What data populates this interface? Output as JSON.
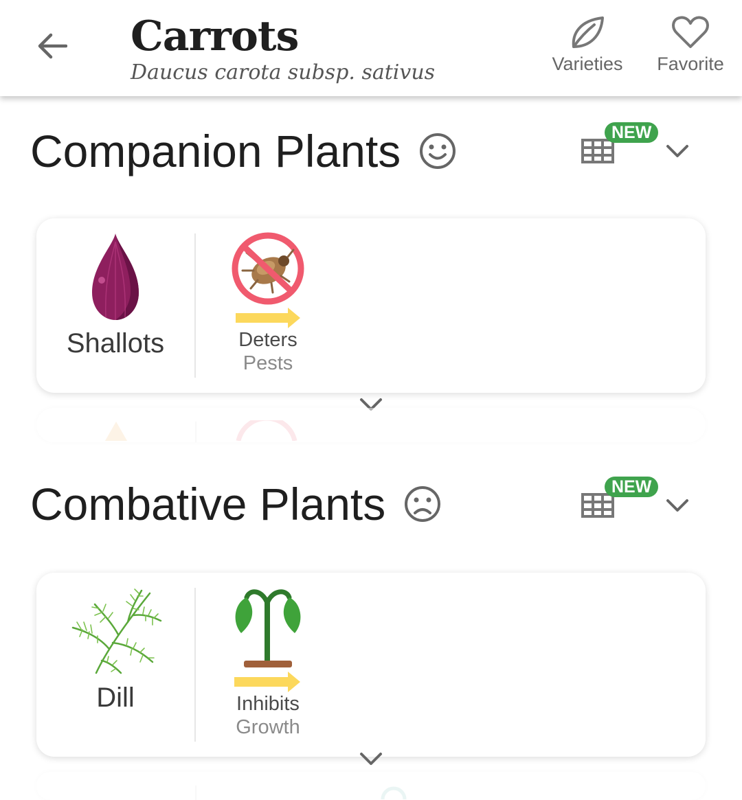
{
  "header": {
    "title": "Carrots",
    "subtitle": "Daucus carota subsp. sativus",
    "actions": [
      {
        "label": "Varieties",
        "icon": "leaf-icon"
      },
      {
        "label": "Favorite",
        "icon": "heart-icon"
      }
    ]
  },
  "sections": [
    {
      "title": "Companion Plants",
      "face_icon": "smile-face-icon",
      "badge": "NEW",
      "plant": {
        "name": "Shallots",
        "icon": "shallot-icon"
      },
      "effect": {
        "line1": "Deters",
        "line2": "Pests",
        "icon": "no-pests-icon"
      }
    },
    {
      "title": "Combative Plants",
      "face_icon": "sad-face-icon",
      "badge": "NEW",
      "plant": {
        "name": "Dill",
        "icon": "dill-icon"
      },
      "effect": {
        "line1": "Inhibits",
        "line2": "Growth",
        "icon": "wilting-plant-icon"
      }
    }
  ],
  "colors": {
    "badge_green": "#3fa34d",
    "arrow_yellow": "#fcd85c",
    "no_sign_red": "#f05a6e",
    "shallot_purple": "#8e1f5e"
  }
}
